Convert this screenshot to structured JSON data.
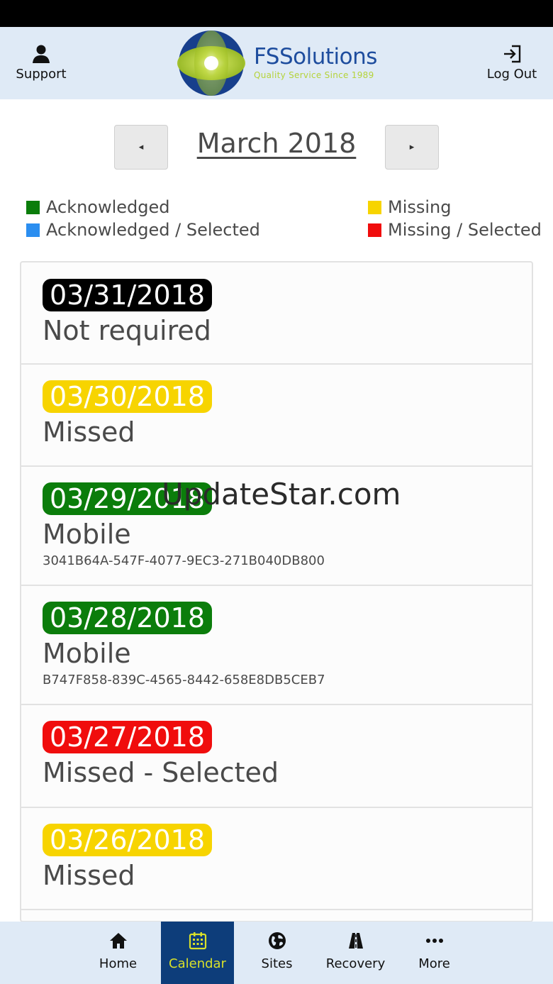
{
  "header": {
    "support_label": "Support",
    "logout_label": "Log Out",
    "logo_name": "FSSolutions",
    "logo_tagline": "Quality Service Since 1989"
  },
  "calendar": {
    "month_title": "March 2018",
    "prev_symbol": "◂",
    "next_symbol": "▸"
  },
  "legend": {
    "acknowledged": "Acknowledged",
    "acknowledged_selected": "Acknowledged / Selected",
    "missing": "Missing",
    "missing_selected": "Missing / Selected",
    "colors": {
      "acknowledged": "#0b7d0b",
      "acknowledged_selected": "#2b8ef0",
      "missing": "#f7d400",
      "missing_selected": "#f00d0d"
    }
  },
  "entries": [
    {
      "date": "03/31/2018",
      "status": "Not required",
      "guid": "",
      "color": "#000000"
    },
    {
      "date": "03/30/2018",
      "status": "Missed",
      "guid": "",
      "color": "#f7d400"
    },
    {
      "date": "03/29/2018",
      "status": "Mobile",
      "guid": "3041B64A-547F-4077-9EC3-271B040DB800",
      "color": "#0b7d0b"
    },
    {
      "date": "03/28/2018",
      "status": "Mobile",
      "guid": "B747F858-839C-4565-8442-658E8DB5CEB7",
      "color": "#0b7d0b"
    },
    {
      "date": "03/27/2018",
      "status": "Missed - Selected",
      "guid": "",
      "color": "#f00d0d"
    },
    {
      "date": "03/26/2018",
      "status": "Missed",
      "guid": "",
      "color": "#f7d400"
    }
  ],
  "watermark": "UpdateStar.com",
  "tabs": {
    "home": "Home",
    "calendar": "Calendar",
    "sites": "Sites",
    "recovery": "Recovery",
    "more": "More"
  },
  "colors": {
    "header_bg": "#dfeaf6",
    "tab_active_bg": "#0d3d7a",
    "tab_active_fg": "#d8e02a"
  }
}
